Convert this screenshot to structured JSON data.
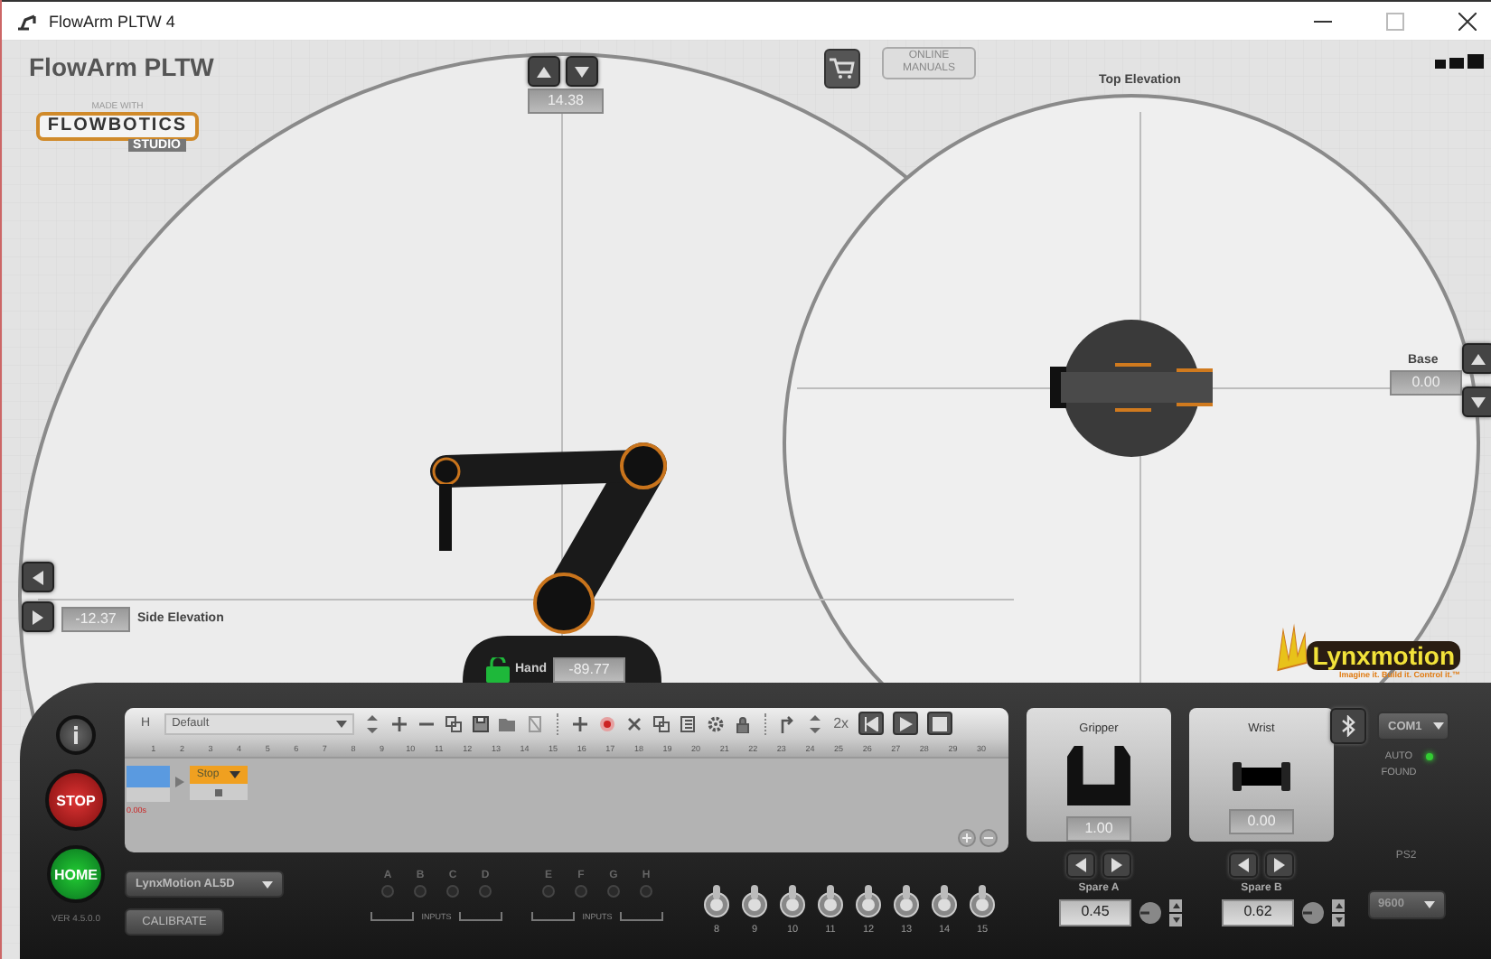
{
  "window": {
    "title": "FlowArm PLTW 4"
  },
  "app_title": "FlowArm PLTW",
  "logo": {
    "made_with": "MADE WITH",
    "name": "FLOWBOTICS",
    "sub": "STUDIO"
  },
  "shoulder": {
    "value": "14.38"
  },
  "online_manuals": "ONLINE MANUALS",
  "top_view": {
    "title": "Top Elevation",
    "base_label": "Base",
    "base_value": "0.00"
  },
  "side_view": {
    "title": "Side Elevation",
    "elbow_value": "-12.37"
  },
  "hand": {
    "label": "Hand",
    "value": "-89.77"
  },
  "brand": {
    "name": "Lynxmotion",
    "tagline": "Imagine it. Build it. Control it.™"
  },
  "controls": {
    "stop": "STOP",
    "home": "HOME",
    "version": "VER 4.5.0.0",
    "robot": "LynxMotion AL5D",
    "calibrate": "CALIBRATE"
  },
  "timeline": {
    "mode": "H",
    "sequence": "Default",
    "speed": "2x",
    "start_time": "0.00s",
    "step": "Stop",
    "ruler": [
      "1",
      "2",
      "3",
      "4",
      "5",
      "6",
      "7",
      "8",
      "9",
      "10",
      "11",
      "12",
      "13",
      "14",
      "15",
      "16",
      "17",
      "18",
      "19",
      "20",
      "21",
      "22",
      "23",
      "24",
      "25",
      "26",
      "27",
      "28",
      "29",
      "30"
    ]
  },
  "inputs": [
    {
      "label": "INPUTS",
      "channels": [
        {
          "name": "A",
          "on": false
        },
        {
          "name": "B",
          "on": false
        },
        {
          "name": "C",
          "on": false
        },
        {
          "name": "D",
          "on": false
        }
      ]
    },
    {
      "label": "INPUTS",
      "channels": [
        {
          "name": "E",
          "on": false
        },
        {
          "name": "F",
          "on": false
        },
        {
          "name": "G",
          "on": false
        },
        {
          "name": "H",
          "on": false
        }
      ]
    }
  ],
  "switches": [
    {
      "label": "8"
    },
    {
      "label": "9"
    },
    {
      "label": "10"
    },
    {
      "label": "11"
    },
    {
      "label": "12"
    },
    {
      "label": "13"
    },
    {
      "label": "14"
    },
    {
      "label": "15"
    }
  ],
  "servos": [
    {
      "title": "Gripper",
      "kind": "gripper",
      "value": "1.00",
      "spare_label": "Spare A",
      "spare_value": "0.45"
    },
    {
      "title": "Wrist",
      "kind": "wrist",
      "value": "0.00",
      "spare_label": "Spare B",
      "spare_value": "0.62"
    }
  ],
  "connection": {
    "port": "COM1",
    "status": "AUTO FOUND",
    "found": true,
    "ps2": "PS2",
    "baud": "9600"
  }
}
